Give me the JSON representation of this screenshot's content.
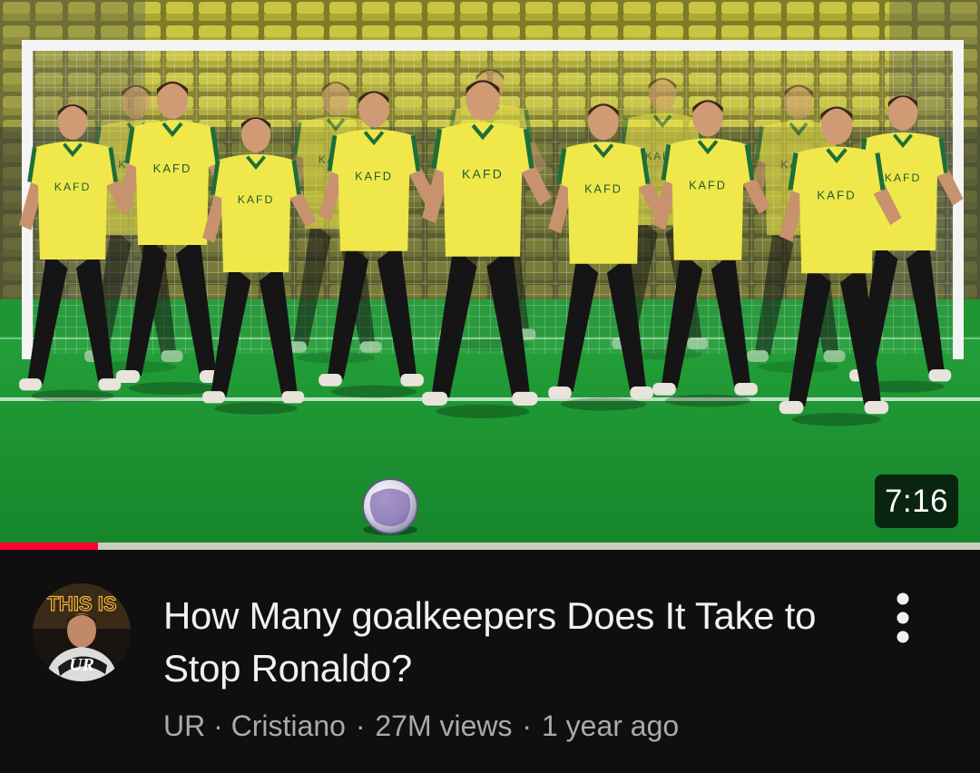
{
  "video": {
    "duration": "7:16",
    "watch_progress": 0.1,
    "title": "How Many goalkeepers Does It Take to Stop Ronaldo?",
    "channel": "UR · Cristiano",
    "views": "27M views",
    "age": "1 year ago",
    "separator": "·",
    "shirt_text": "KAFD"
  },
  "icons": {
    "more": "more-vert-icon"
  },
  "colors": {
    "progress_red": "#ff0033",
    "progress_track": "#c9ccc3",
    "background": "#0f0f0f",
    "title_text": "#f1f1f1",
    "meta_text": "#aaaaaa",
    "jersey_yellow": "#f0e84a",
    "pitch_green": "#1f9a34",
    "seat_yellow": "#e6e04a"
  }
}
